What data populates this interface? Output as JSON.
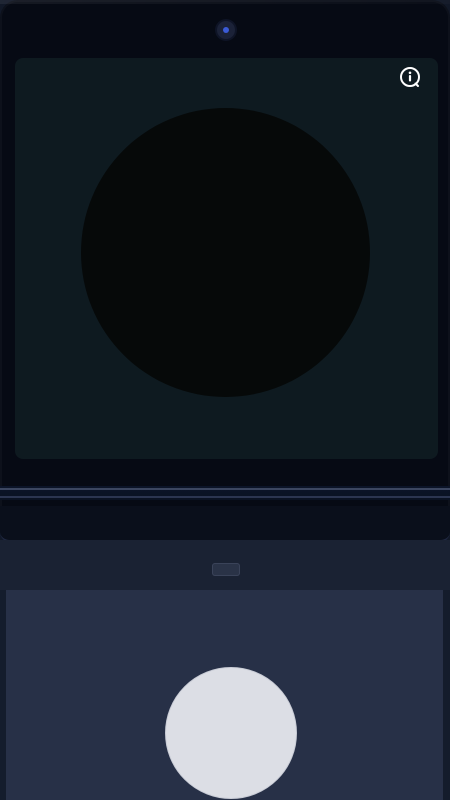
{
  "app": {
    "accent": "#3b5bd6"
  },
  "upper_display": {
    "info_icon": "info-icon",
    "lens_circle_color": "#060909",
    "screen_color": "#0e1a20"
  },
  "lower_display": {
    "speaker_icon": "speaker-grille",
    "capture_button_color": "#dcdee5"
  }
}
